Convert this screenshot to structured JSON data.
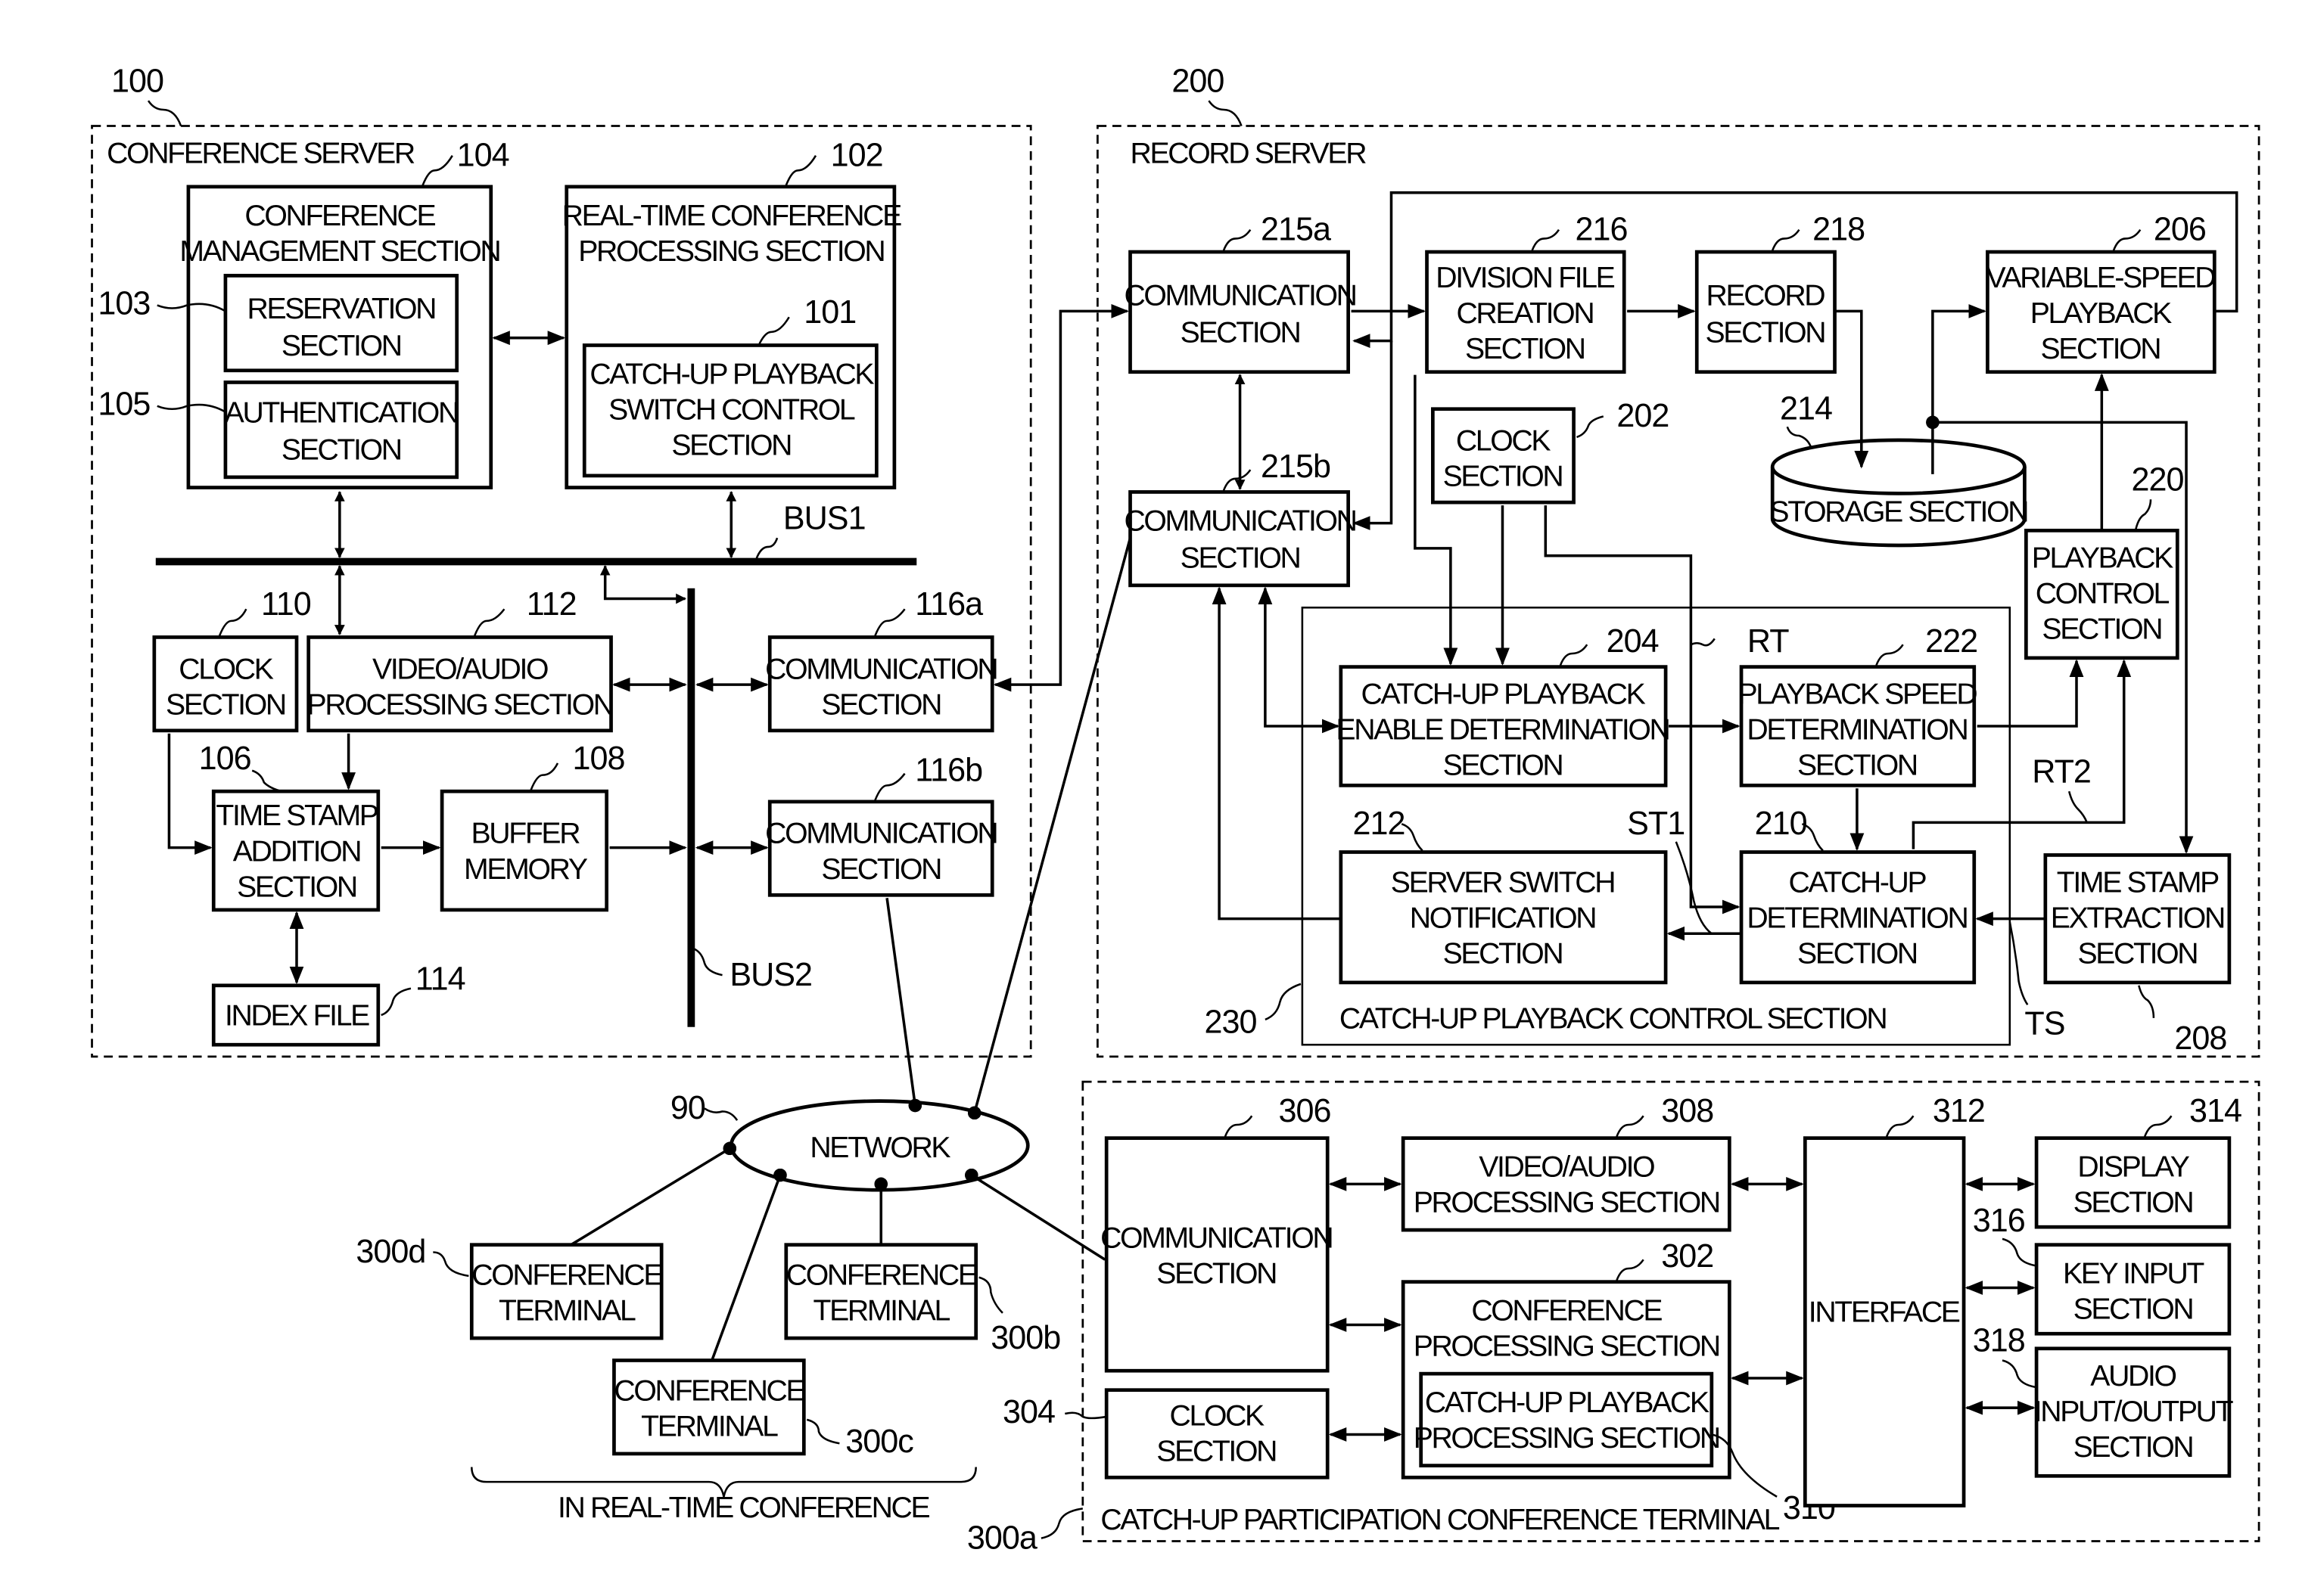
{
  "groups": {
    "conference_server": {
      "ref": "100",
      "title": "CONFERENCE SERVER"
    },
    "record_server": {
      "ref": "200",
      "title": "RECORD SERVER"
    },
    "catchup_terminal": {
      "ref": "300a",
      "title": "CATCH-UP PARTICIPATION CONFERENCE TERMINAL"
    },
    "catchup_control": {
      "ref": "230",
      "title": "CATCH-UP PLAYBACK CONTROL SECTION"
    },
    "realtime_group": {
      "title": "IN REAL-TIME CONFERENCE"
    }
  },
  "conference_server": {
    "conference_management": {
      "ref": "104",
      "lines": [
        "CONFERENCE",
        "MANAGEMENT SECTION"
      ]
    },
    "reservation": {
      "ref": "103",
      "lines": [
        "RESERVATION",
        "SECTION"
      ]
    },
    "authentication": {
      "ref": "105",
      "lines": [
        "AUTHENTICATION",
        "SECTION"
      ]
    },
    "realtime_processing": {
      "ref": "102",
      "lines": [
        "REAL-TIME CONFERENCE",
        "PROCESSING SECTION"
      ]
    },
    "switch_control": {
      "ref": "101",
      "lines": [
        "CATCH-UP PLAYBACK",
        "SWITCH CONTROL",
        "SECTION"
      ]
    },
    "bus1": "BUS1",
    "bus2": "BUS2",
    "clock": {
      "ref": "110",
      "lines": [
        "CLOCK",
        "SECTION"
      ]
    },
    "video_audio": {
      "ref": "112",
      "lines": [
        "VIDEO/AUDIO",
        "PROCESSING SECTION"
      ]
    },
    "comm_a": {
      "ref": "116a",
      "lines": [
        "COMMUNICATION",
        "SECTION"
      ]
    },
    "time_stamp_addition": {
      "ref": "106",
      "lines": [
        "TIME STAMP",
        "ADDITION",
        "SECTION"
      ]
    },
    "buffer_memory": {
      "ref": "108",
      "lines": [
        "BUFFER",
        "MEMORY"
      ]
    },
    "comm_b": {
      "ref": "116b",
      "lines": [
        "COMMUNICATION",
        "SECTION"
      ]
    },
    "index_file": {
      "ref": "114",
      "lines": [
        "INDEX FILE"
      ]
    }
  },
  "record_server": {
    "comm_a": {
      "ref": "215a",
      "lines": [
        "COMMUNICATION",
        "SECTION"
      ]
    },
    "division_file": {
      "ref": "216",
      "lines": [
        "DIVISION FILE",
        "CREATION",
        "SECTION"
      ]
    },
    "record": {
      "ref": "218",
      "lines": [
        "RECORD",
        "SECTION"
      ]
    },
    "variable_speed": {
      "ref": "206",
      "lines": [
        "VARIABLE-SPEED",
        "PLAYBACK",
        "SECTION"
      ]
    },
    "clock": {
      "ref": "202",
      "lines": [
        "CLOCK",
        "SECTION"
      ]
    },
    "storage": {
      "ref": "214",
      "lines": [
        "STORAGE SECTION"
      ]
    },
    "comm_b": {
      "ref": "215b",
      "lines": [
        "COMMUNICATION",
        "SECTION"
      ]
    },
    "playback_control": {
      "ref": "220",
      "lines": [
        "PLAYBACK",
        "CONTROL",
        "SECTION"
      ]
    },
    "enable_determination": {
      "ref": "204",
      "lines": [
        "CATCH-UP PLAYBACK",
        "ENABLE DETERMINATION",
        "SECTION"
      ]
    },
    "speed_determination": {
      "ref": "222",
      "lines": [
        "PLAYBACK SPEED",
        "DETERMINATION",
        "SECTION"
      ]
    },
    "server_switch": {
      "ref": "212",
      "lines": [
        "SERVER SWITCH",
        "NOTIFICATION",
        "SECTION"
      ]
    },
    "catchup_determination": {
      "ref": "210",
      "lines": [
        "CATCH-UP",
        "DETERMINATION",
        "SECTION"
      ]
    },
    "time_stamp_extraction": {
      "ref": "208",
      "lines": [
        "TIME STAMP",
        "EXTRACTION",
        "SECTION"
      ]
    },
    "signals": {
      "rt": "RT",
      "rt2": "RT2",
      "st1": "ST1",
      "ts": "TS"
    }
  },
  "network": {
    "ref": "90",
    "label": "NETWORK",
    "terminals": [
      {
        "ref": "300d",
        "lines": [
          "CONFERENCE",
          "TERMINAL"
        ]
      },
      {
        "ref": "300b",
        "lines": [
          "CONFERENCE",
          "TERMINAL"
        ]
      },
      {
        "ref": "300c",
        "lines": [
          "CONFERENCE",
          "TERMINAL"
        ]
      }
    ]
  },
  "terminal": {
    "comm": {
      "ref": "306",
      "lines": [
        "COMMUNICATION",
        "SECTION"
      ]
    },
    "video_audio": {
      "ref": "308",
      "lines": [
        "VIDEO/AUDIO",
        "PROCESSING SECTION"
      ]
    },
    "conference_processing": {
      "ref": "302",
      "lines": [
        "CONFERENCE",
        "PROCESSING SECTION"
      ]
    },
    "catchup_processing": {
      "ref": "310",
      "lines": [
        "CATCH-UP PLAYBACK",
        "PROCESSING SECTION"
      ]
    },
    "clock": {
      "ref": "304",
      "lines": [
        "CLOCK",
        "SECTION"
      ]
    },
    "interface": {
      "ref": "312",
      "lines": [
        "INTERFACE"
      ]
    },
    "display": {
      "ref": "314",
      "lines": [
        "DISPLAY",
        "SECTION"
      ]
    },
    "key_input": {
      "ref": "316",
      "lines": [
        "KEY INPUT",
        "SECTION"
      ]
    },
    "audio_io": {
      "ref": "318",
      "lines": [
        "AUDIO",
        "INPUT/OUTPUT",
        "SECTION"
      ]
    }
  }
}
